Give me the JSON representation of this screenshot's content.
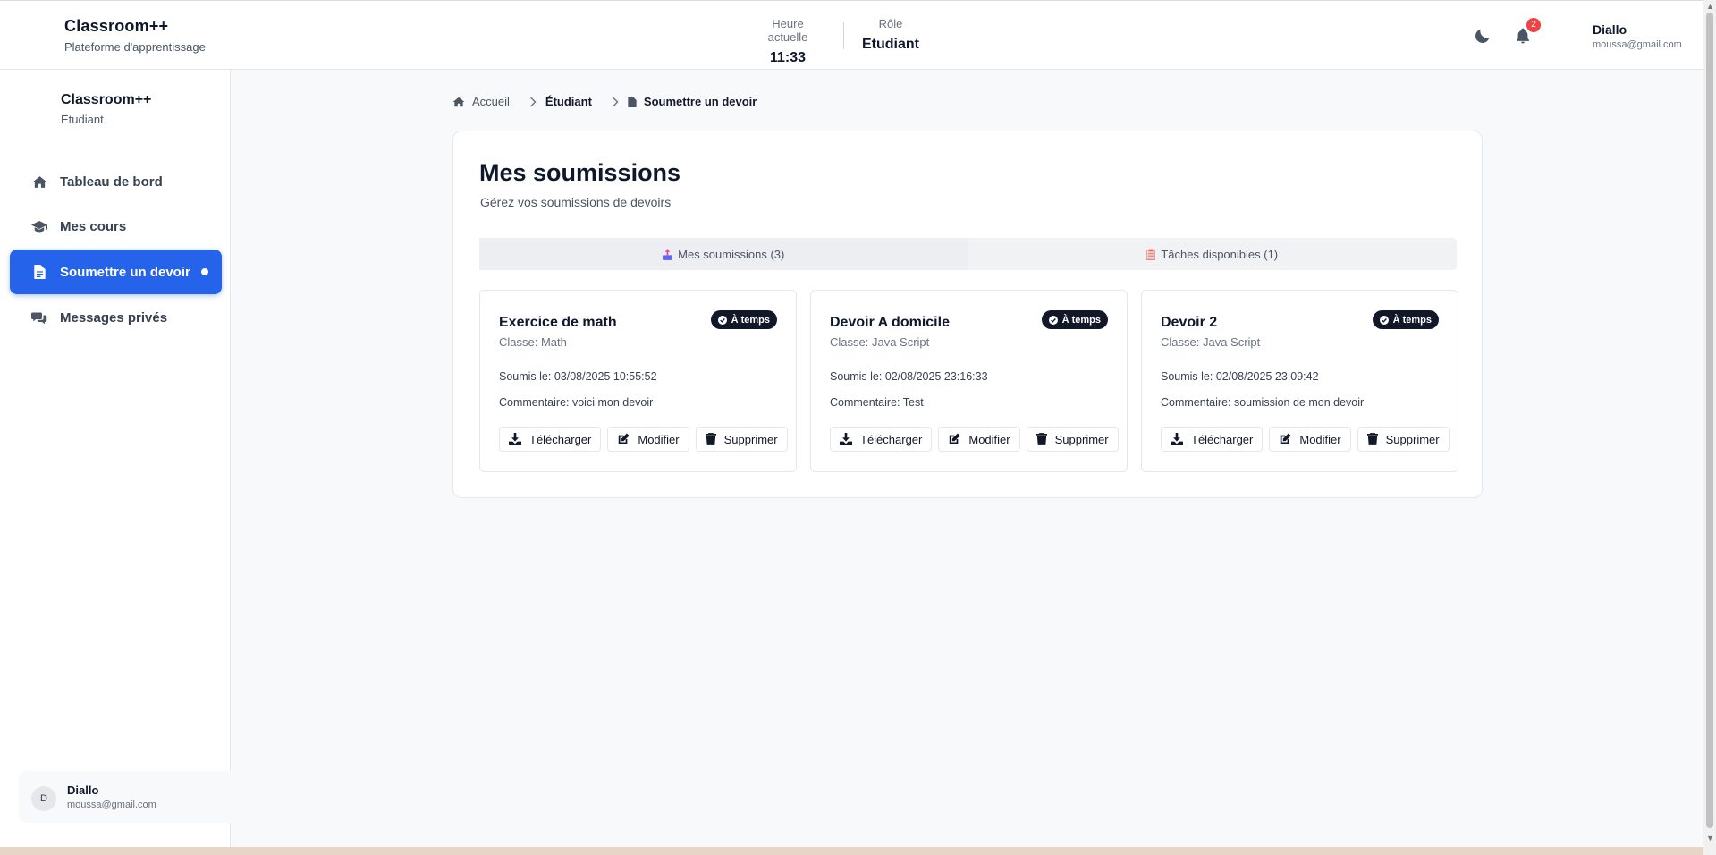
{
  "header": {
    "brand_title": "Classroom++",
    "brand_subtitle": "Plateforme d'apprentissage",
    "clock_label": "Heure actuelle",
    "clock_value": "11:33",
    "role_label": "Rôle",
    "role_value": "Etudiant",
    "notification_count": "2",
    "user_name": "Diallo",
    "user_email": "moussa@gmail.com"
  },
  "sidebar": {
    "brand_title": "Classroom++",
    "brand_subtitle": "Etudiant",
    "items": [
      {
        "label": "Tableau de bord",
        "icon": "home-icon",
        "active": false
      },
      {
        "label": "Mes cours",
        "icon": "graduation-cap-icon",
        "active": false
      },
      {
        "label": "Soumettre un devoir",
        "icon": "file-icon",
        "active": true
      },
      {
        "label": "Messages privés",
        "icon": "comments-icon",
        "active": false
      }
    ],
    "user": {
      "initial": "D",
      "name": "Diallo",
      "email": "moussa@gmail.com"
    }
  },
  "breadcrumb": {
    "home": "Accueil",
    "section": "Étudiant",
    "current": "Soumettre un devoir"
  },
  "main": {
    "title": "Mes soumissions",
    "subtitle": "Gérez vos soumissions de devoirs",
    "tabs": [
      {
        "label": "Mes soumissions (3)",
        "icon": "inbox-icon",
        "active": true
      },
      {
        "label": "Tâches disponibles (1)",
        "icon": "clipboard-icon",
        "active": false
      }
    ],
    "submissions": [
      {
        "title": "Exercice de math",
        "class": "Classe: Math",
        "status": "À temps",
        "date": "Soumis le: 03/08/2025 10:55:52",
        "comment": "Commentaire: voici mon devoir"
      },
      {
        "title": "Devoir A domicile",
        "class": "Classe: Java Script",
        "status": "À temps",
        "date": "Soumis le: 02/08/2025 23:16:33",
        "comment": "Commentaire: Test"
      },
      {
        "title": "Devoir 2",
        "class": "Classe: Java Script",
        "status": "À temps",
        "date": "Soumis le: 02/08/2025 23:09:42",
        "comment": "Commentaire: soumission de mon devoir"
      }
    ],
    "actions": {
      "download": "Télécharger",
      "edit": "Modifier",
      "delete": "Supprimer"
    }
  },
  "colors": {
    "accent": "#2563eb",
    "status_badge": "#111827",
    "notification": "#ef4444"
  }
}
